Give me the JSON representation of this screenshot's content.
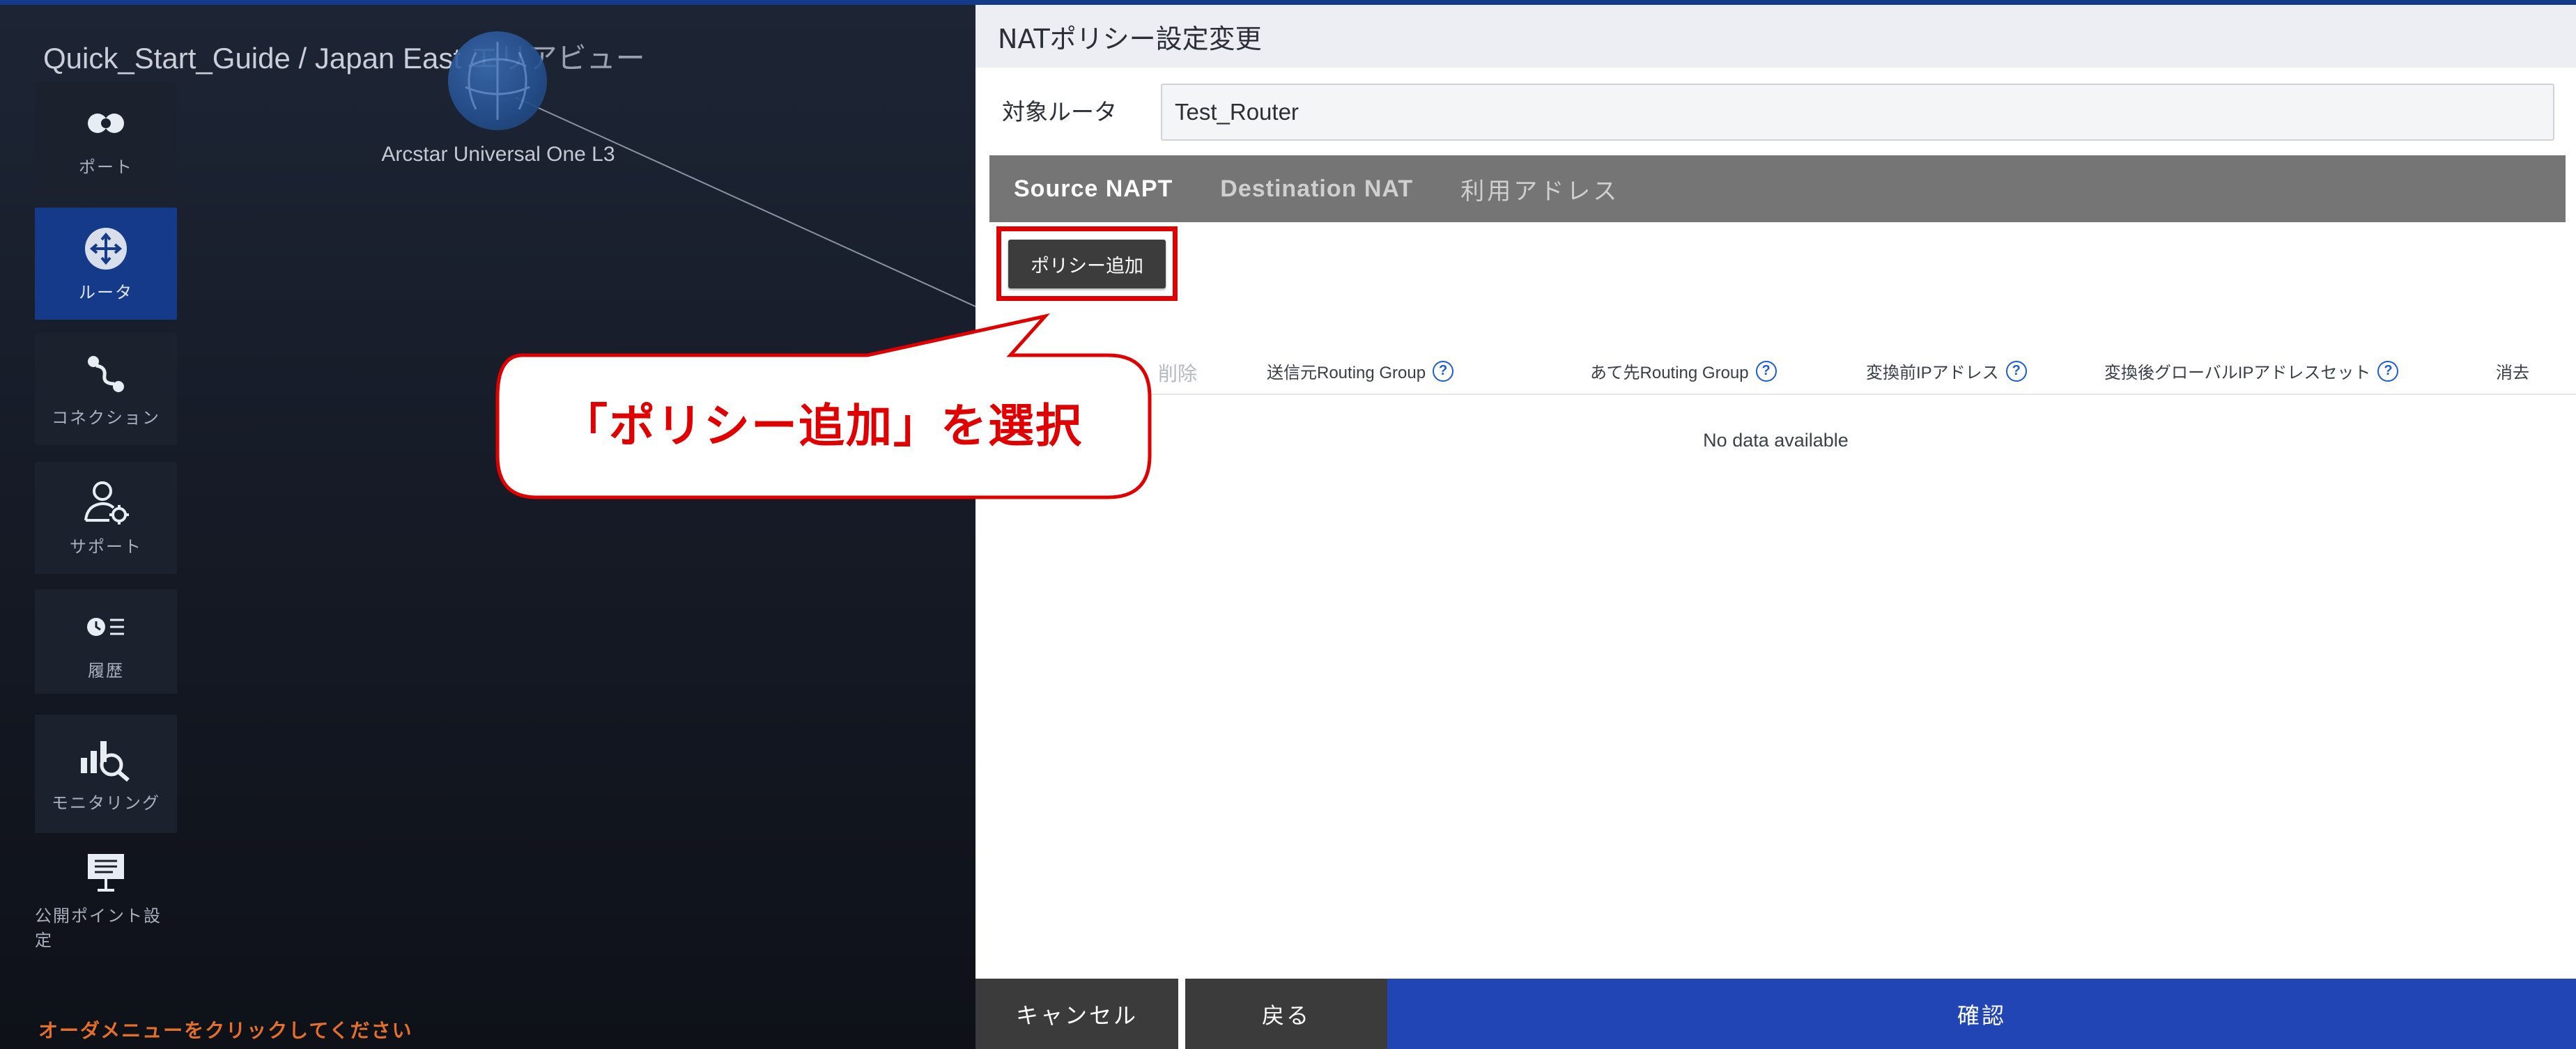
{
  "area": {
    "title": "Quick_Start_Guide / Japan East",
    "title_suffix": "エリアビュー",
    "node_label": "Arcstar Universal One L3",
    "order_hint": "オーダメニューをクリックしてください"
  },
  "sidebar": {
    "items": [
      {
        "label": "ポート",
        "icon": "port-icon"
      },
      {
        "label": "ルータ",
        "icon": "router-icon"
      },
      {
        "label": "コネクション",
        "icon": "connection-icon"
      },
      {
        "label": "サポート",
        "icon": "support-icon"
      },
      {
        "label": "履歴",
        "icon": "history-icon"
      },
      {
        "label": "モニタリング",
        "icon": "monitoring-icon"
      },
      {
        "label": "公開ポイント設定",
        "icon": "public-point-icon"
      }
    ],
    "active_index": 1
  },
  "panel": {
    "title": "NATポリシー設定変更",
    "router_label": "対象ルータ",
    "router_value": "Test_Router",
    "tabs": [
      "Source NAPT",
      "Destination NAT",
      "利用アドレス"
    ],
    "active_tab": 0,
    "add_policy_label": "ポリシー追加",
    "table": {
      "headers": [
        "削除",
        "送信元Routing Group",
        "あて先Routing Group",
        "変換前IPアドレス",
        "変換後グローバルIPアドレスセット",
        "消去"
      ],
      "empty_text": "No data available",
      "help_icon_text": "?"
    },
    "footer": {
      "cancel": "キャンセル",
      "back": "戻る",
      "confirm": "確認"
    }
  },
  "callout": {
    "text": "「ポリシー追加」を選択"
  },
  "colors": {
    "active_nav": "#163a8a",
    "confirm": "#2145b5",
    "highlight": "#e00000",
    "hint": "#e2702c"
  }
}
